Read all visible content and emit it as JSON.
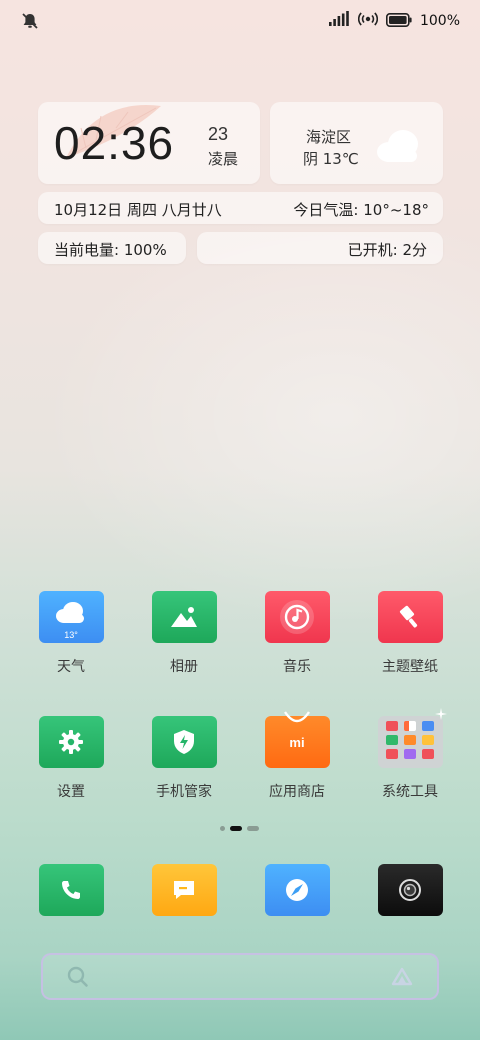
{
  "status_bar": {
    "left_icon": "mute-bell-icon",
    "signal_icon": "cellular-signal-icon",
    "hotspot_icon": "hotspot-icon",
    "battery_icon": "battery-icon",
    "battery_percent": "100%"
  },
  "clock_widget": {
    "time": "02:36",
    "day": "23",
    "period": "凌晨"
  },
  "weather_widget": {
    "location": "海淀区",
    "condition": "阴 13℃",
    "icon": "cloud-icon"
  },
  "date_bar": {
    "date": "10月12日 周四 八月廿八",
    "temp_range": "今日气温: 10°~18°"
  },
  "battery_bar": {
    "text": "当前电量: 100%"
  },
  "uptime_bar": {
    "text": "已开机: 2分"
  },
  "apps_row1": [
    {
      "label": "天气",
      "icon": "weather-app-icon",
      "badge": "13°",
      "color": "#3d9ff4"
    },
    {
      "label": "相册",
      "icon": "gallery-app-icon",
      "color": "#25b569"
    },
    {
      "label": "音乐",
      "icon": "music-app-icon",
      "color": "#ff4a5e"
    },
    {
      "label": "主题壁纸",
      "icon": "themes-app-icon",
      "color": "#ff4a5e"
    }
  ],
  "apps_row2": [
    {
      "label": "设置",
      "icon": "settings-app-icon",
      "color": "#25b569"
    },
    {
      "label": "手机管家",
      "icon": "security-app-icon",
      "color": "#25b569"
    },
    {
      "label": "应用商店",
      "icon": "app-store-icon",
      "brand": "mi",
      "color": "#ff7a1a"
    },
    {
      "label": "系统工具",
      "icon": "system-tools-folder-icon",
      "color": "#cfd3d4"
    }
  ],
  "page_indicator": {
    "pages": 3,
    "active": 1
  },
  "dock": [
    {
      "icon": "phone-app-icon",
      "color": "#25b569"
    },
    {
      "icon": "messages-app-icon",
      "color": "#ffb81c"
    },
    {
      "icon": "browser-app-icon",
      "color": "#3d9ff4"
    },
    {
      "icon": "camera-app-icon",
      "color": "#151515"
    }
  ],
  "search_bar": {
    "search_icon": "search-icon",
    "assistant_icon": "assistant-triangle-icon"
  }
}
